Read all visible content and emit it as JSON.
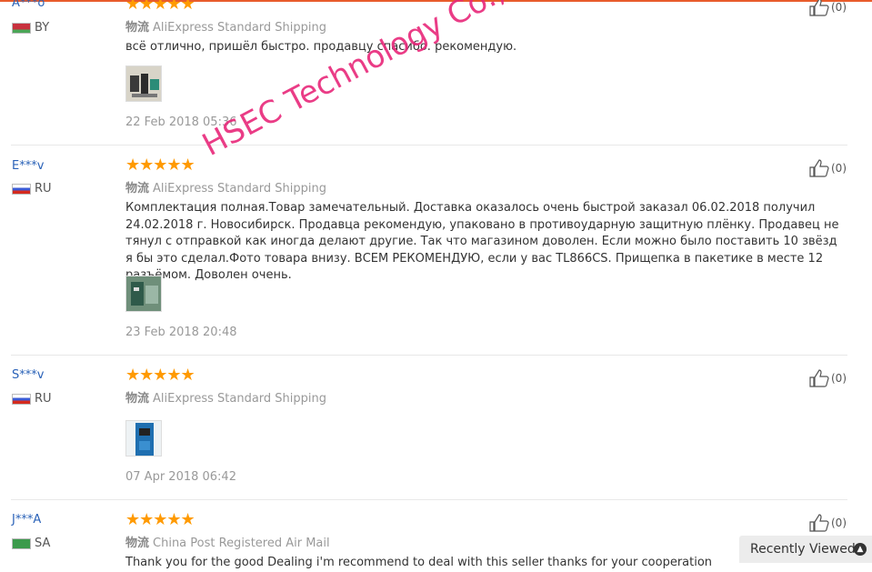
{
  "reviews": [
    {
      "user": "A***o",
      "country": "BY",
      "stars": "★★★★★",
      "shipping_label": "物流",
      "shipping": "AliExpress Standard Shipping",
      "text": "всё отлично, пришёл быстро. продавцу спасибо. рекомендую.",
      "date": "22 Feb 2018 05:36",
      "likes": "(0)"
    },
    {
      "user": "E***v",
      "country": "RU",
      "stars": "★★★★★",
      "shipping_label": "物流",
      "shipping": "AliExpress Standard Shipping",
      "text": "Комплектация полная.Товар замечательный. Доставка оказалось очень быстрой заказал 06.02.2018 получил 24.02.2018 г. Новосибирск. Продавца рекомендую, упаковано в противоударную защитную плёнку. Продавец не тянул с отправкой как иногда делают другие. Так что магазином доволен. Если можно было поставить 10 звёзд я бы это сделал.Фото товара внизу. ВСЕМ РЕКОМЕНДУЮ, если у вас TL866CS. Прищепка в пакетике в месте 12 разъёмом. Доволен очень.",
      "date": "23 Feb 2018 20:48",
      "likes": "(0)"
    },
    {
      "user": "S***v",
      "country": "RU",
      "stars": "★★★★★",
      "shipping_label": "物流",
      "shipping": "AliExpress Standard Shipping",
      "text": "",
      "date": "07 Apr 2018 06:42",
      "likes": "(0)"
    },
    {
      "user": "J***A",
      "country": "SA",
      "stars": "★★★★★",
      "shipping_label": "物流",
      "shipping": "China Post Registered Air Mail",
      "text": "Thank you for the good Dealing i'm recommend to deal with this seller thanks for your cooperation",
      "date": "",
      "likes": "(0)"
    }
  ],
  "watermark": "HSEC Technology Co., Ltd.",
  "recently_viewed": "Recently Viewed",
  "colors": {
    "accent": "#e85c2c",
    "stars": "#ff9a00",
    "username": "#2a62b8",
    "watermark": "#e8287a"
  }
}
